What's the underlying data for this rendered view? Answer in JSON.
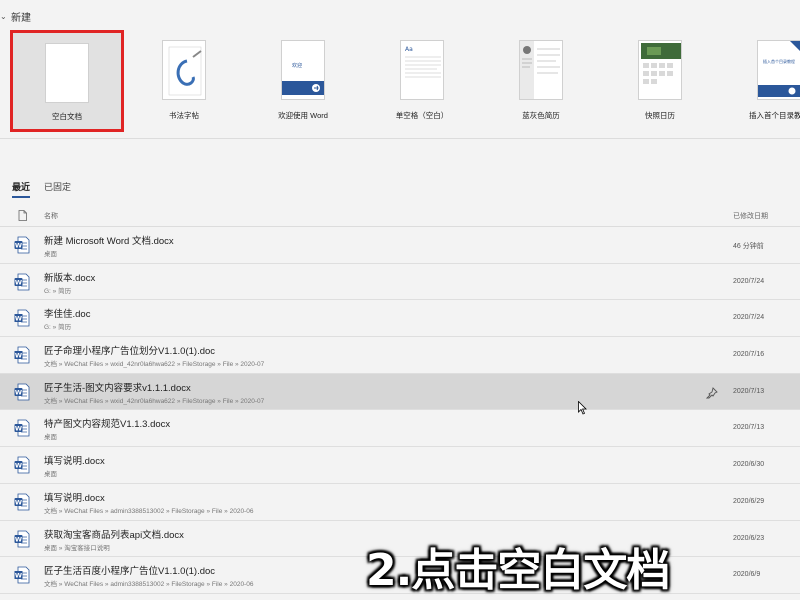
{
  "new_section": {
    "title": "新建"
  },
  "templates": [
    {
      "name": "空白文档",
      "selected": true,
      "kind": "blank"
    },
    {
      "name": "书法字帖",
      "selected": false,
      "kind": "calligraphy"
    },
    {
      "name": "欢迎使用 Word",
      "selected": false,
      "kind": "welcome",
      "thumb_text": "欢迎"
    },
    {
      "name": "单空格（空白）",
      "selected": false,
      "kind": "single",
      "thumb_text": "Aa"
    },
    {
      "name": "蓝灰色简历",
      "selected": false,
      "kind": "resume"
    },
    {
      "name": "快照日历",
      "selected": false,
      "kind": "calendar"
    },
    {
      "name": "插入首个目录教程",
      "selected": false,
      "kind": "toc",
      "thumb_text": "插入首个目录教程"
    }
  ],
  "tabs": [
    {
      "label": "最近",
      "active": true
    },
    {
      "label": "已固定",
      "active": false
    }
  ],
  "columns": {
    "name": "名称",
    "date": "已修改日期"
  },
  "files": [
    {
      "name": "新建 Microsoft Word 文档.docx",
      "path": "桌面",
      "date": "46 分钟前",
      "icon": "docx",
      "highlighted": false
    },
    {
      "name": "新版本.docx",
      "path": "G: » 简历",
      "date": "2020/7/24",
      "icon": "docx",
      "highlighted": false
    },
    {
      "name": "李佳佳.doc",
      "path": "G: » 简历",
      "date": "2020/7/24",
      "icon": "doc",
      "highlighted": false
    },
    {
      "name": "匠子命理小程序广告位划分V1.1.0(1).doc",
      "path": "文档 » WeChat Files » wxid_42nr0la6hwa622 » FileStorage » File » 2020-07",
      "date": "2020/7/16",
      "icon": "doc",
      "highlighted": false
    },
    {
      "name": "匠子生活-图文内容要求v1.1.1.docx",
      "path": "文档 » WeChat Files » wxid_42nr0la6hwa622 » FileStorage » File » 2020-07",
      "date": "2020/7/13",
      "icon": "docx",
      "highlighted": true
    },
    {
      "name": "特产图文内容规范V1.1.3.docx",
      "path": "桌面",
      "date": "2020/7/13",
      "icon": "docx",
      "highlighted": false
    },
    {
      "name": "填写说明.docx",
      "path": "桌面",
      "date": "2020/6/30",
      "icon": "docx",
      "highlighted": false
    },
    {
      "name": "填写说明.docx",
      "path": "文档 » WeChat Files » admin3388513002 » FileStorage » File » 2020-06",
      "date": "2020/6/29",
      "icon": "docx",
      "highlighted": false
    },
    {
      "name": "获取淘宝客商品列表api文档.docx",
      "path": "桌面 » 淘宝客接口说明",
      "date": "2020/6/23",
      "icon": "docx",
      "highlighted": false
    },
    {
      "name": "匠子生活百度小程序广告位V1.1.0(1).doc",
      "path": "文档 » WeChat Files » admin3388513002 » FileStorage » File » 2020-06",
      "date": "2020/6/9",
      "icon": "doc",
      "highlighted": false
    }
  ],
  "caption": "2.点击空白文档",
  "colors": {
    "accent": "#2b579a",
    "selection_border": "#e02424",
    "highlight_row": "#d6d6d6"
  }
}
